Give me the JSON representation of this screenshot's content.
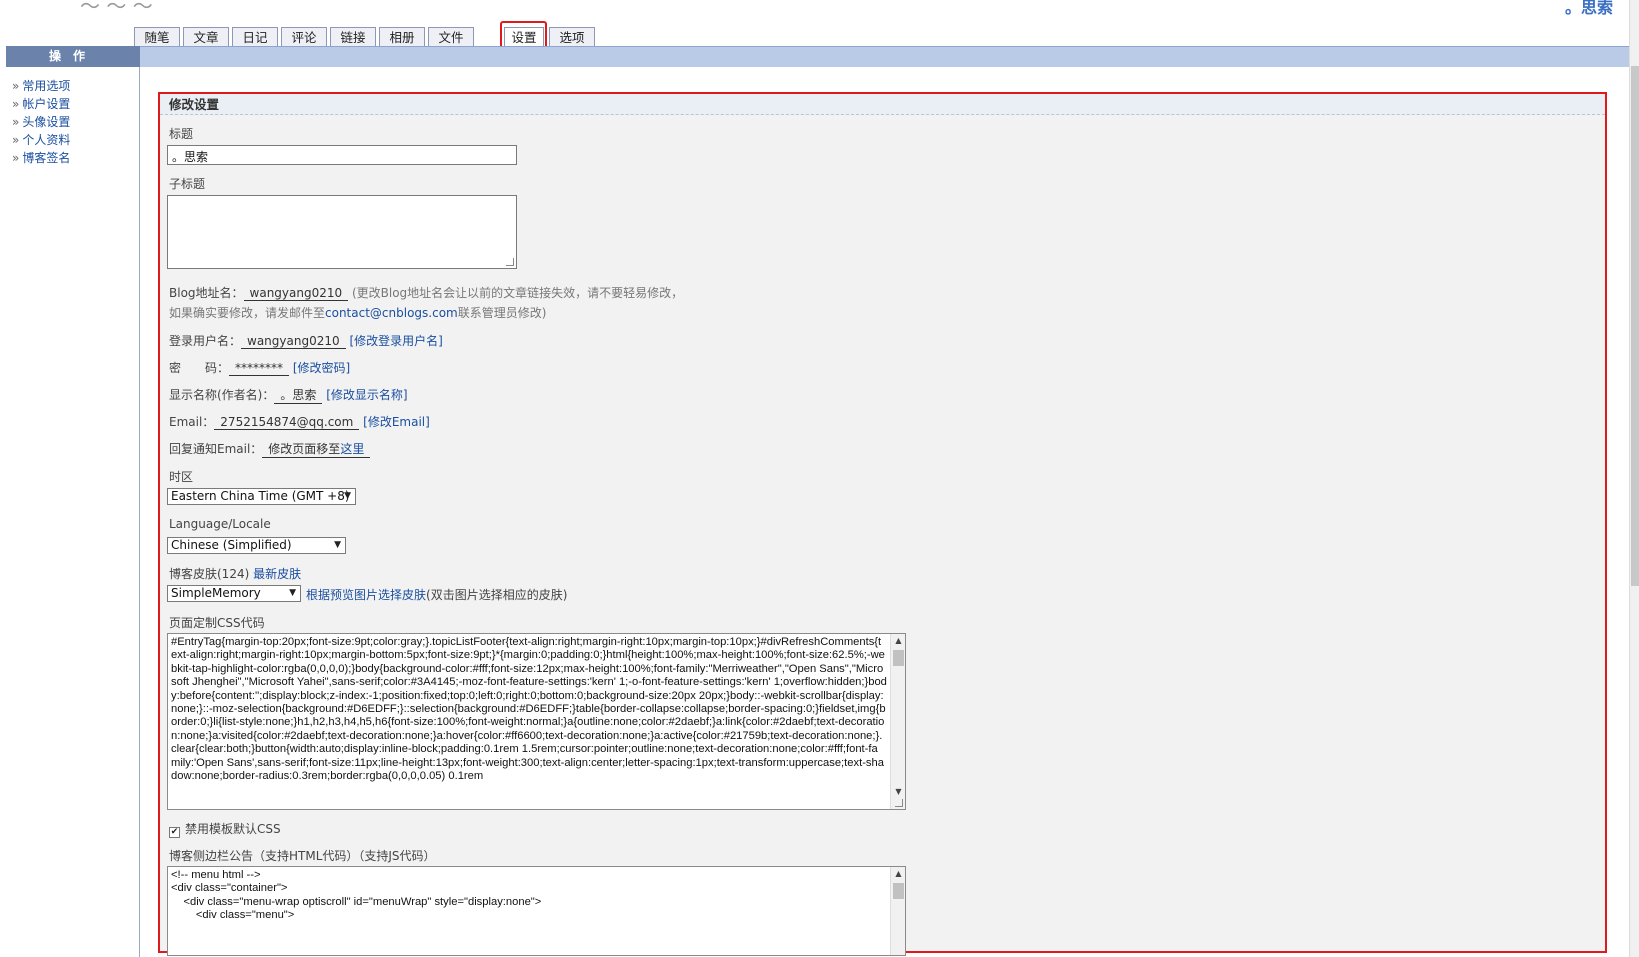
{
  "brand": "。思索",
  "tabs": [
    "随笔",
    "文章",
    "日记",
    "评论",
    "链接",
    "相册",
    "文件",
    "设置",
    "选项"
  ],
  "sidebar": {
    "header": "操作",
    "items": [
      "常用选项",
      "帐户设置",
      "头像设置",
      "个人资料",
      "博客签名"
    ]
  },
  "panel": {
    "title": "修改设置",
    "title_label": "标题",
    "title_value": "。思索",
    "subtitle_label": "子标题",
    "subtitle_value": "",
    "blog_addr_label": "Blog地址名：",
    "blog_addr_value": "wangyang0210",
    "blog_addr_note": "(更改Blog地址名会让以前的文章链接失效，请不要轻易修改，",
    "blog_addr_note2_pre": "如果确实要修改，请发邮件至",
    "blog_addr_email": "contact@cnblogs.com",
    "blog_addr_note2_post": "联系管理员修改)",
    "login_label": "登录用户名：",
    "login_value": "wangyang0210",
    "login_link": "[修改登录用户名]",
    "pwd_label": "密　　码：",
    "pwd_value": "********",
    "pwd_link": "[修改密码]",
    "display_label": "显示名称(作者名)：",
    "display_value": "。思索",
    "display_link": "[修改显示名称]",
    "email_label": "Email：",
    "email_value": "2752154874@qq.com",
    "email_link": "[修改Email]",
    "reply_label": "回复通知Email：",
    "reply_value_pre": "修改页面移至",
    "reply_value_link": "这里",
    "tz_label": "时区",
    "tz_value": "Eastern China Time (GMT +8)",
    "lang_label": "Language/Locale",
    "lang_value": "Chinese (Simplified)",
    "skin_label": "博客皮肤(124)",
    "skin_newest": "最新皮肤",
    "skin_value": "SimpleMemory",
    "skin_preview_link": "根据预览图片选择皮肤",
    "skin_preview_note": "(双击图片选择相应的皮肤)",
    "css_label": "页面定制CSS代码",
    "css_code": "#EntryTag{margin-top:20px;font-size:9pt;color:gray;}.topicListFooter{text-align:right;margin-right:10px;margin-top:10px;}#divRefreshComments{text-align:right;margin-right:10px;margin-bottom:5px;font-size:9pt;}*{margin:0;padding:0;}html{height:100%;max-height:100%;font-size:62.5%;-webkit-tap-highlight-color:rgba(0,0,0,0);}body{background-color:#fff;font-size:12px;max-height:100%;font-family:\"Merriweather\",\"Open Sans\",\"Microsoft Jhenghei\",\"Microsoft Yahei\",sans-serif;color:#3A4145;-moz-font-feature-settings:'kern' 1;-o-font-feature-settings:'kern' 1;overflow:hidden;}body:before{content:'';display:block;z-index:-1;position:fixed;top:0;left:0;right:0;bottom:0;background-size:20px 20px;}body::-webkit-scrollbar{display:none;}::-moz-selection{background:#D6EDFF;}::selection{background:#D6EDFF;}table{border-collapse:collapse;border-spacing:0;}fieldset,img{border:0;}li{list-style:none;}h1,h2,h3,h4,h5,h6{font-size:100%;font-weight:normal;}a{outline:none;color:#2daebf;}a:link{color:#2daebf;text-decoration:none;}a:visited{color:#2daebf;text-decoration:none;}a:hover{color:#ff6600;text-decoration:none;}a:active{color:#21759b;text-decoration:none;}.clear{clear:both;}button{width:auto;display:inline-block;padding:0.1rem 1.5rem;cursor:pointer;outline:none;text-decoration:none;color:#fff;font-family:'Open Sans',sans-serif;font-size:11px;line-height:13px;font-weight:300;text-align:center;letter-spacing:1px;text-transform:uppercase;text-shadow:none;border-radius:0.3rem;border:rgba(0,0,0,0.05) 0.1rem",
    "disable_css_label": "禁用模板默认CSS",
    "sidebar_notice_label": "博客侧边栏公告（支持HTML代码）（支持JS代码）",
    "sidebar_notice_code": "<!-- menu html -->\n<div class=\"container\">\n    <div class=\"menu-wrap optiscroll\" id=\"menuWrap\" style=\"display:none\">\n        <div class=\"menu\">"
  }
}
